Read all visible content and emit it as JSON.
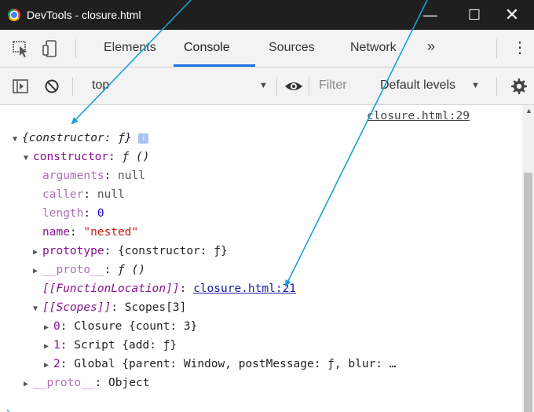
{
  "window": {
    "title": "DevTools - closure.html",
    "minimize_glyph": "—",
    "maximize_glyph": "☐",
    "close_glyph": "✕"
  },
  "tabs": {
    "items": [
      "Elements",
      "Console",
      "Sources",
      "Network"
    ],
    "active": "Console",
    "more_glyph": "»",
    "kebab_glyph": "⋮"
  },
  "toolbar": {
    "context": "top",
    "filter_placeholder": "Filter",
    "levels": "Default levels"
  },
  "console": {
    "source_link": "closure.html:29",
    "lines": {
      "l1_text": "{constructor: ƒ}",
      "l1_badge": "i",
      "l2_key": "constructor",
      "l2_val": "ƒ ()",
      "l3_key": "arguments",
      "l3_val": "null",
      "l4_key": "caller",
      "l4_val": "null",
      "l5_key": "length",
      "l5_val": "0",
      "l6_key": "name",
      "l6_val": "\"nested\"",
      "l7_key": "prototype",
      "l7_val": "{constructor: ƒ}",
      "l8_key": "__proto__",
      "l8_val": "ƒ ()",
      "l9_key": "[[FunctionLocation]]",
      "l9_val": "closure.html:21",
      "l10_key": "[[Scopes]]",
      "l10_val": "Scopes[3]",
      "l11_key": "0",
      "l11_val": "Closure {count: 3}",
      "l12_key": "1",
      "l12_val": "Script {add: ƒ}",
      "l13_key": "2",
      "l13_val": "Global {parent: Window, postMessage: ƒ, blur: …",
      "l14_key": "__proto__",
      "l14_val": "Object"
    }
  },
  "colors": {
    "annotation_arrow": "#1a9fd6",
    "titlebar": "#1f1f1f",
    "accent": "#1a73e8"
  },
  "icons": [
    "chrome-logo-icon",
    "inspect-element-icon",
    "device-toolbar-icon",
    "sidebar-toggle-icon",
    "clear-console-icon",
    "eye-icon",
    "gear-icon"
  ]
}
